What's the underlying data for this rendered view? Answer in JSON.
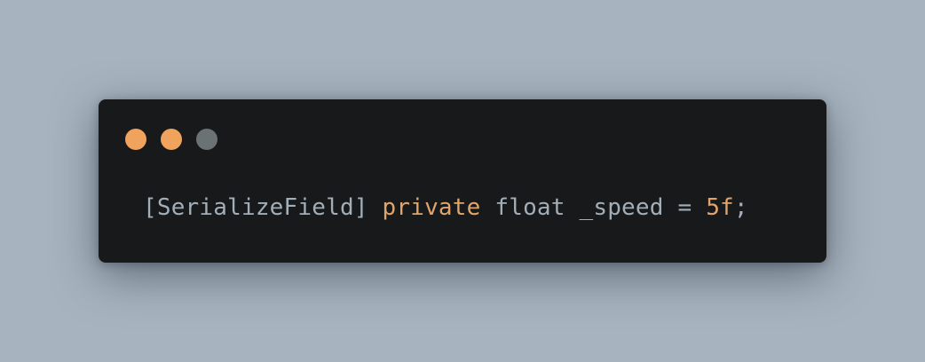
{
  "window": {
    "controls": [
      {
        "name": "close",
        "color": "#f0a35c"
      },
      {
        "name": "minimize",
        "color": "#f0a35c"
      },
      {
        "name": "maximize",
        "color": "#6b7274"
      }
    ]
  },
  "code": {
    "tokens": [
      {
        "text": "[SerializeField]",
        "kind": "attribute",
        "color": "#a2aeb8"
      },
      {
        "text": " ",
        "kind": "space",
        "color": "#a2aeb8"
      },
      {
        "text": "private",
        "kind": "keyword",
        "color": "#e0a56b"
      },
      {
        "text": " ",
        "kind": "space",
        "color": "#a2aeb8"
      },
      {
        "text": "float",
        "kind": "type",
        "color": "#a2aeb8"
      },
      {
        "text": " ",
        "kind": "space",
        "color": "#a2aeb8"
      },
      {
        "text": "_speed",
        "kind": "identifier",
        "color": "#a2aeb8"
      },
      {
        "text": " ",
        "kind": "space",
        "color": "#a2aeb8"
      },
      {
        "text": "=",
        "kind": "operator",
        "color": "#a2aeb8"
      },
      {
        "text": " ",
        "kind": "space",
        "color": "#a2aeb8"
      },
      {
        "text": "5f",
        "kind": "number",
        "color": "#e0a56b"
      },
      {
        "text": ";",
        "kind": "punctuation",
        "color": "#a2aeb8"
      }
    ]
  }
}
